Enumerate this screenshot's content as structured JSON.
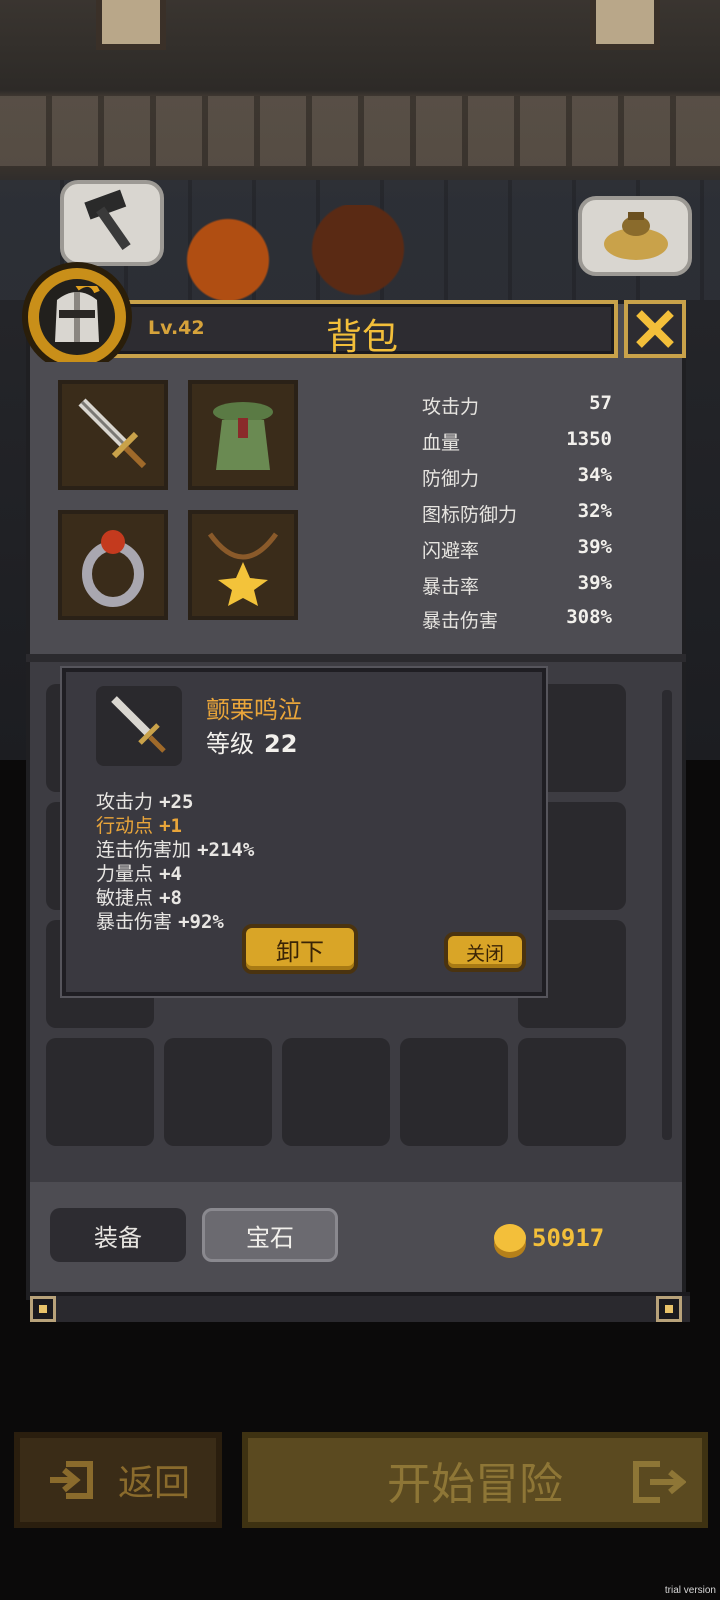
{
  "header": {
    "level": "Lv.42",
    "title": "背包"
  },
  "stats": [
    {
      "label": "攻击力",
      "value": "57"
    },
    {
      "label": "血量",
      "value": "1350"
    },
    {
      "label": "防御力",
      "value": "34%"
    },
    {
      "label": "图标防御力",
      "value": "32%"
    },
    {
      "label": "闪避率",
      "value": "39%"
    },
    {
      "label": "暴击率",
      "value": "39%"
    },
    {
      "label": "暴击伤害",
      "value": "308%"
    }
  ],
  "equipment": [
    "sword-icon",
    "robe-icon",
    "ring-icon",
    "star-necklace-icon"
  ],
  "tooltip": {
    "item_name": "颤栗鸣泣",
    "level_label": "等级",
    "level_value": "22",
    "attributes": [
      {
        "label": "攻击力",
        "value": "+25",
        "highlight": false
      },
      {
        "label": "行动点",
        "value": "+1",
        "highlight": true
      },
      {
        "label": "连击伤害加",
        "value": "+214%",
        "highlight": false
      },
      {
        "label": "力量点",
        "value": "+4",
        "highlight": false
      },
      {
        "label": "敏捷点",
        "value": "+8",
        "highlight": false
      },
      {
        "label": "暴击伤害",
        "value": "+92%",
        "highlight": false
      }
    ],
    "unequip_label": "卸下",
    "close_label": "关闭"
  },
  "tabs": {
    "equip": "装备",
    "gem": "宝石"
  },
  "currency": {
    "gold": "50917"
  },
  "buttons": {
    "back": "返回",
    "start": "开始冒险"
  },
  "watermark": "trial version",
  "colors": {
    "gold": "#f3bf3a",
    "panel": "#4d4c52",
    "highlight": "#e9a53a"
  }
}
